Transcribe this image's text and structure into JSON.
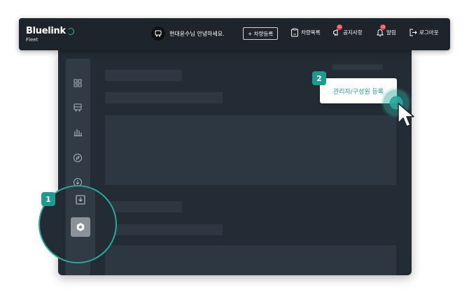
{
  "header": {
    "brand": "Bluelink",
    "brand_sub": "Fleet",
    "greeting": "현대윤수님 안녕하세요.",
    "register_button": "+ 차량등록",
    "nav": [
      {
        "label": "차량목록",
        "icon": "clipboard-icon"
      },
      {
        "label": "공지사항",
        "icon": "megaphone-icon",
        "badge": "10"
      },
      {
        "label": "알림",
        "icon": "bell-icon",
        "badge": "10"
      },
      {
        "label": "로그아웃",
        "icon": "logout-icon"
      }
    ]
  },
  "sidebar": {
    "items": [
      {
        "icon": "dashboard-grid-icon"
      },
      {
        "icon": "bus-icon"
      },
      {
        "icon": "bar-chart-icon"
      },
      {
        "icon": "compass-icon"
      },
      {
        "icon": "download-circle-icon"
      },
      {
        "icon": "download-box-icon"
      },
      {
        "icon": "settings-icon",
        "active": true
      }
    ]
  },
  "steps": {
    "step1": "1",
    "step2": "2"
  },
  "tooltip": {
    "label": "관리자/구성원 등록"
  },
  "colors": {
    "accent": "#1e9a8e",
    "header_bg": "#1d242b",
    "panel_bg": "#232c35",
    "sidebar_bg": "#313b45",
    "badge": "#e94545"
  }
}
